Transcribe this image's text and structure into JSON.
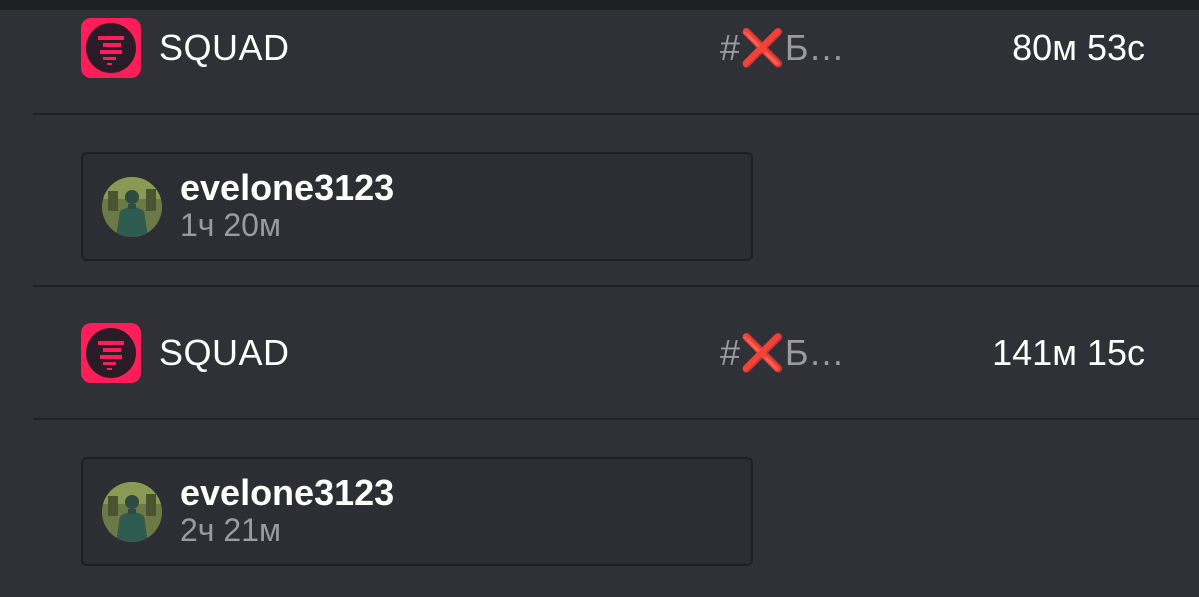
{
  "colors": {
    "background": "#303136",
    "accent": "#ff1e5a",
    "text_primary": "#ffffff",
    "text_secondary": "#9a9ba0",
    "error_mark": "#dd2e44"
  },
  "sessions": [
    {
      "app_name": "SQUAD",
      "app_icon": "squad-logo-icon",
      "channel_prefix": "#",
      "channel_mark": "❌",
      "channel_name": "Б…",
      "duration": "80м 53с",
      "user": {
        "avatar": "user-avatar",
        "username": "evelone3123",
        "time": "1ч 20м"
      }
    },
    {
      "app_name": "SQUAD",
      "app_icon": "squad-logo-icon",
      "channel_prefix": "#",
      "channel_mark": "❌",
      "channel_name": "Б…",
      "duration": "141м 15с",
      "user": {
        "avatar": "user-avatar",
        "username": "evelone3123",
        "time": "2ч 21м"
      }
    }
  ]
}
